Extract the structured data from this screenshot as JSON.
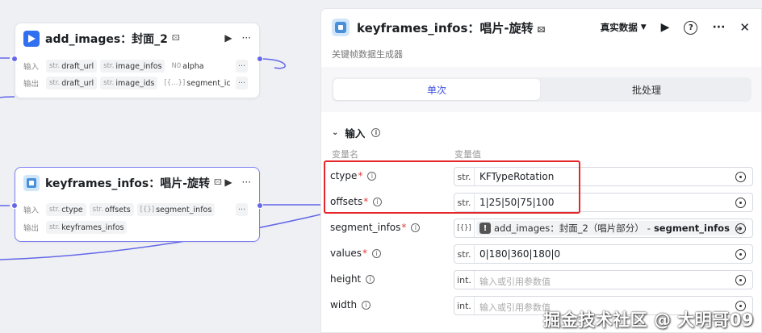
{
  "nodes": {
    "add_images": {
      "title": "add_images：封面_2",
      "input_label": "输入",
      "output_label": "输出",
      "inputs": [
        {
          "type": "str.",
          "name": "draft_url"
        },
        {
          "type": "str.",
          "name": "image_infos"
        },
        {
          "type": "N0",
          "name": "alpha"
        }
      ],
      "outputs": [
        {
          "type": "str.",
          "name": "draft_url"
        },
        {
          "type": "str.",
          "name": "image_ids"
        },
        {
          "type": "[{…}]",
          "name": "segment_ic"
        }
      ],
      "more": "···"
    },
    "keyframes": {
      "title": "keyframes_infos：唱片-旋转",
      "input_label": "输入",
      "output_label": "输出",
      "inputs": [
        {
          "type": "str.",
          "name": "ctype"
        },
        {
          "type": "str.",
          "name": "offsets"
        },
        {
          "type": "[{}]",
          "name": "segment_infos"
        }
      ],
      "outputs": [
        {
          "type": "str.",
          "name": "keyframes_infos"
        }
      ],
      "more": "···"
    }
  },
  "panel": {
    "title": "keyframes_infos：唱片-旋转",
    "subtitle": "关键帧数据生成器",
    "data_mode": "真实数据",
    "help_label": "?",
    "more_label": "···",
    "close_label": "✕",
    "tabs": [
      "单次",
      "批处理"
    ],
    "active_tab": 0,
    "section_title": "输入",
    "col_name": "变量名",
    "col_value": "变量值",
    "params": [
      {
        "name": "ctype",
        "required": true,
        "type": "str.",
        "value": "KFTypeRotation",
        "placeholder": ""
      },
      {
        "name": "offsets",
        "required": true,
        "type": "str.",
        "value": "1|25|50|75|100",
        "placeholder": ""
      },
      {
        "name": "segment_infos",
        "required": true,
        "type": "[{}]",
        "ref": {
          "source": "add_images：封面_2（唱片部分）",
          "sep": "-",
          "field": "segment_infos",
          "close": "×"
        }
      },
      {
        "name": "values",
        "required": true,
        "type": "str.",
        "value": "0|180|360|180|0",
        "placeholder": ""
      },
      {
        "name": "height",
        "required": false,
        "type": "int.",
        "value": "",
        "placeholder": "输入或引用参数值"
      },
      {
        "name": "width",
        "required": false,
        "type": "int.",
        "value": "",
        "placeholder": "输入或引用参数值"
      }
    ]
  },
  "watermark": "掘金技术社区 @ 大明哥09",
  "colors": {
    "accent": "#3c4fe0",
    "port": "#6467e8",
    "highlight": "#e5262a",
    "required": "#e23b3b"
  }
}
